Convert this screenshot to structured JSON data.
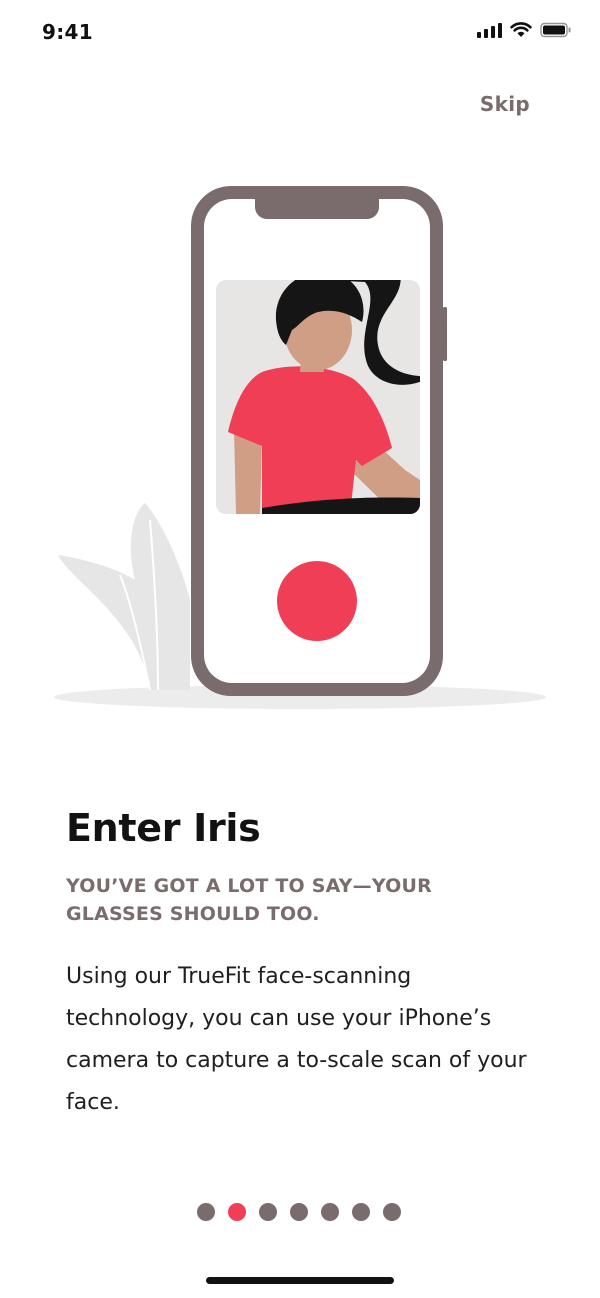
{
  "status_bar": {
    "time": "9:41",
    "icons": [
      "signal-icon",
      "wifi-icon",
      "battery-icon"
    ]
  },
  "skip": {
    "label": "Skip"
  },
  "onboarding": {
    "title": "Enter Iris",
    "subtitle": "YOU’VE GOT A LOT TO SAY—YOUR GLASSES SHOULD TOO.",
    "body": "Using our TrueFit face-scanning technology, you can use your iPhone’s camera to capture a to-scale scan of your face."
  },
  "pager": {
    "total": 7,
    "active_index": 1
  },
  "colors": {
    "accent": "#ef3e55",
    "muted": "#7a6b6d",
    "phone_frame": "#7a6b6d",
    "skin": "#d09d85",
    "hair": "#151515",
    "leaf": "#e6e6e6"
  }
}
